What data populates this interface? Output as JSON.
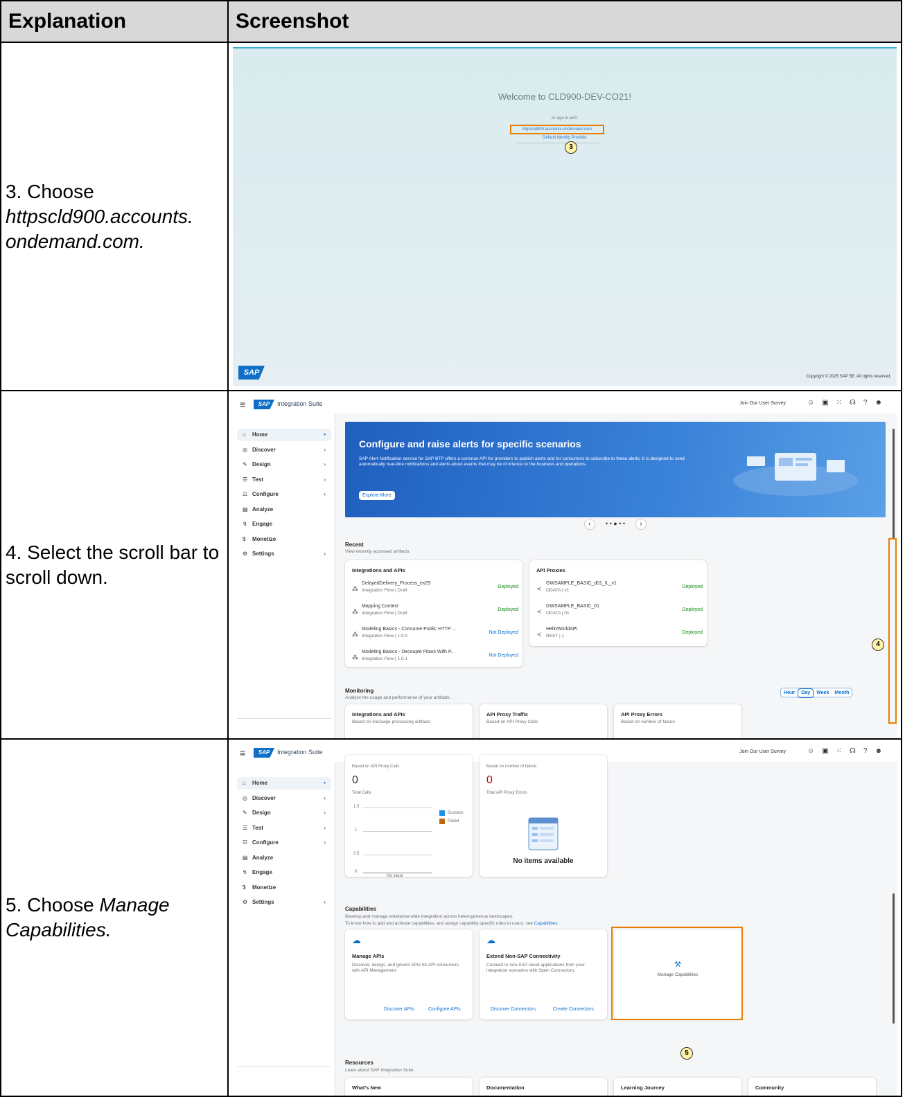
{
  "header": {
    "col1": "Explanation",
    "col2": "Screenshot"
  },
  "step3": {
    "explanation_prefix": "3. Choose",
    "explanation_italic": "httpscld900.accounts.\nondemand.com.",
    "welcome": "Welcome to CLD900-DEV-CO21!",
    "or_sign_in": "or sign in with:",
    "idp_link": "httpscld900.accounts.ondemand.com",
    "default_idp": "Default Identity Provider",
    "callout": "3",
    "logo": "SAP",
    "copyright": "Copyright © 2025 SAP SE. All rights reserved."
  },
  "step4": {
    "explanation": "4. Select the scroll bar to scroll down.",
    "callout": "4"
  },
  "step5": {
    "explanation_prefix": "5. Choose",
    "explanation_italic": "Manage Capabilities.",
    "callout": "5"
  },
  "shell": {
    "logo": "SAP",
    "title": "Integration Suite",
    "survey": "Join Our User Survey",
    "icons": [
      "feedback-icon",
      "notifications-icon",
      "apps-grid-icon",
      "support-icon",
      "help-icon",
      "user-icon"
    ]
  },
  "nav": [
    {
      "label": "Home",
      "icon": "home-icon",
      "active": true
    },
    {
      "label": "Discover",
      "icon": "compass-icon",
      "chevron": true
    },
    {
      "label": "Design",
      "icon": "pencil-icon",
      "chevron": true
    },
    {
      "label": "Test",
      "icon": "checklist-icon",
      "chevron": true
    },
    {
      "label": "Configure",
      "icon": "configure-icon",
      "chevron": true
    },
    {
      "label": "Analyze",
      "icon": "chart-icon"
    },
    {
      "label": "Engage",
      "icon": "engage-icon"
    },
    {
      "label": "Monetize",
      "icon": "money-icon"
    },
    {
      "label": "Settings",
      "icon": "settings-icon",
      "chevron": true
    }
  ],
  "banner": {
    "title": "Configure and raise alerts for specific scenarios",
    "text": "SAP Alert Notification service for SAP BTP offers a common API for providers to publish alerts and for consumers to subscribe to these alerts. It is designed to send automatically real-time notifications and alerts about events that may be of interest to the business and operations.",
    "button": "Explore More"
  },
  "pager": {
    "prev": "‹",
    "dots": "• • ● • •",
    "next": "›"
  },
  "recent": {
    "title": "Recent",
    "subtitle": "View recently accessed artifacts.",
    "integrations": {
      "title": "Integrations and APIs",
      "items": [
        {
          "name": "DelayedDelivery_Process_ex29",
          "meta": "Integration Flow  |  Draft",
          "status": "Deployed"
        },
        {
          "name": "Mapping Context",
          "meta": "Integration Flow  |  Draft",
          "status": "Deployed"
        },
        {
          "name": "Modeling Basics - Consume Public HTTP ...",
          "meta": "Integration Flow  |  1.0.0",
          "status": "Not Deployed"
        },
        {
          "name": "Modeling Basics - Decouple Flows With P...",
          "meta": "Integration Flow  |  1.0.1",
          "status": "Not Deployed"
        }
      ]
    },
    "proxies": {
      "title": "API Proxies",
      "items": [
        {
          "name": "GWSAMPLE_BASIC_d01_IL_v1",
          "meta": "ODATA  |  v1",
          "status": "Deployed"
        },
        {
          "name": "GWSAMPLE_BASIC_01",
          "meta": "ODATA  |  01",
          "status": "Deployed"
        },
        {
          "name": "HelloWorldAPI",
          "meta": "REST  |  1",
          "status": "Deployed"
        }
      ]
    }
  },
  "monitoring": {
    "title": "Monitoring",
    "subtitle": "Analyze the usage and performance of your artifacts.",
    "segments": [
      "Hour",
      "Day",
      "Week",
      "Month"
    ],
    "selected": "Day",
    "cards": [
      {
        "title": "Integrations and APIs",
        "sub": "Based on message processing artifacts"
      },
      {
        "title": "API Proxy Traffic",
        "sub": "Based on API Proxy Calls"
      },
      {
        "title": "API Proxy Errors",
        "sub": "Based on number of failure"
      }
    ]
  },
  "traffic": {
    "sub": "Based on API Proxy Calls",
    "value": "0",
    "label": "Total Calls",
    "ticks": [
      "1.5",
      "1",
      "0.5",
      "0"
    ],
    "novalue": "No value",
    "legend": [
      {
        "name": "Success",
        "color": "#1b90e6"
      },
      {
        "name": "Failed",
        "color": "#c0680e"
      }
    ]
  },
  "errors": {
    "sub": "Based on number of failure",
    "value": "0",
    "label": "Total API Proxy Errors",
    "empty": "No items available"
  },
  "capabilities": {
    "title": "Capabilities",
    "line1": "Develop and manage enterprise-wide integration across heterogeneous landscapes.",
    "line2": "To know how to add and activate capabilities, and assign capability-specific roles to users, see",
    "link": "Capabilities.",
    "cards": [
      {
        "title": "Manage APIs",
        "text": "Discover, design, and govern APIs for API consumers with API Management.",
        "links": [
          "Discover APIs",
          "Configure APIs"
        ]
      },
      {
        "title": "Extend Non-SAP Connectivity",
        "text": "Connect to non-SAP cloud applications from your integration scenarios with Open Connectors.",
        "links": [
          "Discover Connectors",
          "Create Connectors"
        ]
      }
    ],
    "manage": "Manage Capabilities"
  },
  "resources": {
    "title": "Resources",
    "subtitle": "Learn about SAP Integration Suite.",
    "cards": [
      "What's New",
      "Documentation",
      "Learning Journey",
      "Community"
    ]
  }
}
